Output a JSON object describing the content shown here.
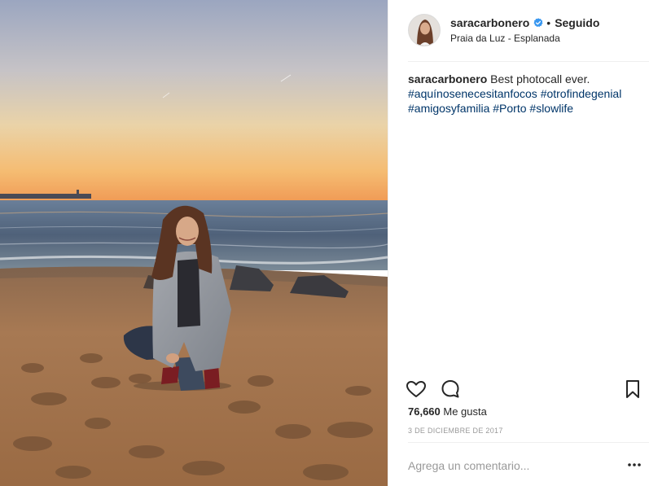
{
  "post": {
    "image": {
      "description": "",
      "sky_top_color": "#9fa9c2",
      "sunset_color": "#f2a25c",
      "sea_color": "#56677e",
      "sand_color": "#a97a52"
    },
    "header": {
      "username": "saracarbonero",
      "verified_icon": "verified-badge-icon",
      "separator": "•",
      "follow_status": "Seguido",
      "location": "Praia da Luz - Esplanada"
    },
    "caption": {
      "username": "saracarbonero",
      "text": "Best photocall ever.",
      "hashtags": [
        "#aquínosenecesitanfocos",
        "#otrofindegenial",
        "#amigosyfamilia",
        "#Porto",
        "#slowlife"
      ]
    },
    "actions": {
      "like_icon": "heart-icon",
      "comment_icon": "comment-bubble-icon",
      "save_icon": "bookmark-icon"
    },
    "likes": {
      "count": "76,660",
      "label": "Me gusta"
    },
    "date": "3 DE DICIEMBRE DE 2017",
    "comment": {
      "placeholder": "Agrega un comentario...",
      "value": "",
      "more_icon": "more-options-icon"
    }
  },
  "colors": {
    "text": "#262626",
    "hashtag": "#003569",
    "muted": "#999999",
    "verified": "#3897f0",
    "divider": "#efefef"
  }
}
